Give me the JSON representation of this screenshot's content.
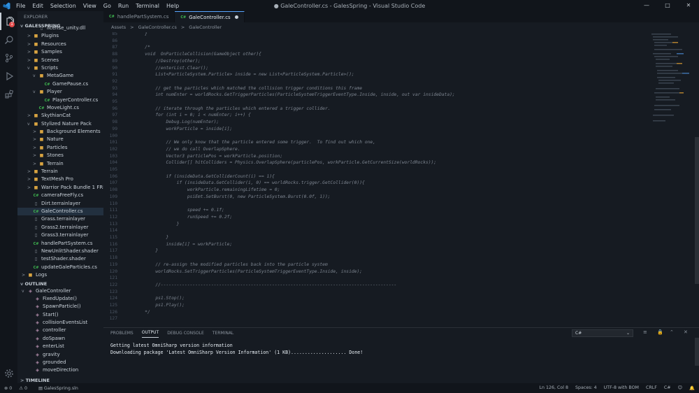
{
  "window": {
    "title": "● GaleController.cs - GalesSpring - Visual Studio Code",
    "controls": [
      "—",
      "□",
      "✕"
    ]
  },
  "menu": [
    "File",
    "Edit",
    "Selection",
    "View",
    "Go",
    "Run",
    "Terminal",
    "Help"
  ],
  "activity": {
    "badge": "1"
  },
  "sidebar": {
    "header": "EXPLORER",
    "project": "GALESSPRING",
    "tree": [
      {
        "label": "license_unity.dll",
        "type": "file",
        "depth": 2,
        "chev": ""
      },
      {
        "label": "Plugins",
        "type": "folder",
        "depth": 1,
        "chev": ">"
      },
      {
        "label": "Resources",
        "type": "folder",
        "depth": 1,
        "chev": ">"
      },
      {
        "label": "Samples",
        "type": "folder",
        "depth": 1,
        "chev": ">"
      },
      {
        "label": "Scenes",
        "type": "folder",
        "depth": 1,
        "chev": ">"
      },
      {
        "label": "Scripts",
        "type": "folder",
        "depth": 1,
        "chev": "v"
      },
      {
        "label": "MetaGame",
        "type": "folder",
        "depth": 2,
        "chev": "v"
      },
      {
        "label": "GamePause.cs",
        "type": "cs",
        "depth": 3,
        "chev": ""
      },
      {
        "label": "Player",
        "type": "folder",
        "depth": 2,
        "chev": "v"
      },
      {
        "label": "PlayerController.cs",
        "type": "cs",
        "depth": 3,
        "chev": ""
      },
      {
        "label": "MoveLight.cs",
        "type": "cs",
        "depth": 2,
        "chev": ""
      },
      {
        "label": "SkythianCat",
        "type": "folder",
        "depth": 1,
        "chev": ">"
      },
      {
        "label": "Stylized Nature Pack",
        "type": "folder",
        "depth": 1,
        "chev": "v"
      },
      {
        "label": "Background Elements",
        "type": "folder",
        "depth": 2,
        "chev": ">"
      },
      {
        "label": "Nature",
        "type": "folder",
        "depth": 2,
        "chev": ">"
      },
      {
        "label": "Particles",
        "type": "folder",
        "depth": 2,
        "chev": ">"
      },
      {
        "label": "Stones",
        "type": "folder",
        "depth": 2,
        "chev": ">"
      },
      {
        "label": "Terrain",
        "type": "folder",
        "depth": 2,
        "chev": ">"
      },
      {
        "label": "Terrain",
        "type": "folder",
        "depth": 1,
        "chev": ">"
      },
      {
        "label": "TextMesh Pro",
        "type": "folder",
        "depth": 1,
        "chev": ">"
      },
      {
        "label": "Warrior Pack Bundle 1 FREE",
        "type": "folder",
        "depth": 1,
        "chev": ">"
      },
      {
        "label": "cameraFreeFly.cs",
        "type": "cs",
        "depth": 1,
        "chev": ""
      },
      {
        "label": "Dirt.terrainlayer",
        "type": "file",
        "depth": 1,
        "chev": ""
      },
      {
        "label": "GaleController.cs",
        "type": "cs",
        "depth": 1,
        "chev": "",
        "selected": true
      },
      {
        "label": "Grass.terrainlayer",
        "type": "file",
        "depth": 1,
        "chev": ""
      },
      {
        "label": "Grass2.terrainlayer",
        "type": "file",
        "depth": 1,
        "chev": ""
      },
      {
        "label": "Grass3.terrainlayer",
        "type": "file",
        "depth": 1,
        "chev": ""
      },
      {
        "label": "handlePartSystem.cs",
        "type": "cs",
        "depth": 1,
        "chev": ""
      },
      {
        "label": "NewUnlitShader.shader",
        "type": "file",
        "depth": 1,
        "chev": ""
      },
      {
        "label": "testShader.shader",
        "type": "file",
        "depth": 1,
        "chev": ""
      },
      {
        "label": "updateGaleParticles.cs",
        "type": "cs",
        "depth": 1,
        "chev": ""
      },
      {
        "label": "Logs",
        "type": "folder",
        "depth": 0,
        "chev": ">"
      }
    ],
    "outline_header": "OUTLINE",
    "outline": [
      {
        "label": "GaleController",
        "depth": 0,
        "chev": "v"
      },
      {
        "label": "FixedUpdate()",
        "depth": 1
      },
      {
        "label": "SpawnParticle()",
        "depth": 1
      },
      {
        "label": "Start()",
        "depth": 1
      },
      {
        "label": "collisionEventsList",
        "depth": 1
      },
      {
        "label": "controller",
        "depth": 1
      },
      {
        "label": "doSpawn",
        "depth": 1
      },
      {
        "label": "enterList",
        "depth": 1
      },
      {
        "label": "gravity",
        "depth": 1
      },
      {
        "label": "grounded",
        "depth": 1
      },
      {
        "label": "moveDirection",
        "depth": 1
      }
    ],
    "timeline_header": "TIMELINE"
  },
  "tabs": [
    {
      "label": "handlePartSystem.cs",
      "active": false
    },
    {
      "label": "GaleController.cs",
      "active": true
    }
  ],
  "breadcrumbs": [
    "Assets",
    ">",
    "GaleController.cs",
    ">",
    "GaleController"
  ],
  "code": [
    {
      "n": "85",
      "t": "    }"
    },
    {
      "n": "86",
      "t": ""
    },
    {
      "n": "87",
      "t": "    /*"
    },
    {
      "n": "88",
      "t": "    void  OnParticleCollision(GameObject other){"
    },
    {
      "n": "89",
      "t": "        //Destroy(other);"
    },
    {
      "n": "90",
      "t": "        //enterList.Clear();"
    },
    {
      "n": "91",
      "t": "        List<ParticleSystem.Particle> inside = new List<ParticleSystem.Particle>();"
    },
    {
      "n": "92",
      "t": ""
    },
    {
      "n": "93",
      "t": "        // get the particles which matched the collision trigger conditions this frame"
    },
    {
      "n": "94",
      "t": "        int numEnter = worldRocks.GetTriggerParticles(ParticleSystemTriggerEventType.Inside, inside, out var insideData);"
    },
    {
      "n": "95",
      "t": ""
    },
    {
      "n": "96",
      "t": "        // iterate through the particles which entered a trigger collider."
    },
    {
      "n": "97",
      "t": "        for (int i = 0; i < numEnter; i++) {"
    },
    {
      "n": "98",
      "t": "            Debug.Log(numEnter);"
    },
    {
      "n": "99",
      "t": "            workParticle = inside[i];"
    },
    {
      "n": "100",
      "t": ""
    },
    {
      "n": "101",
      "t": "            // We only know that the particle entered some trigger.  To find out which one,"
    },
    {
      "n": "102",
      "t": "            // we do call OverlapSphere."
    },
    {
      "n": "103",
      "t": "            Vector3 particlePos = workParticle.position;"
    },
    {
      "n": "104",
      "t": "            Collider[] hitColliders = Physics.OverlapSphere(particlePos, workParticle.GetCurrentSize(worldRocks));"
    },
    {
      "n": "105",
      "t": ""
    },
    {
      "n": "106",
      "t": "            if (insideData.GetColliderCount(i) == 1){"
    },
    {
      "n": "107",
      "t": "                if (insideData.GetCollider(i, 0) == worldRocks.trigger.GetCollider(0)){"
    },
    {
      "n": "108",
      "t": "                    workParticle.remainingLifetime = 0;"
    },
    {
      "n": "109",
      "t": "                    psiEmt.SetBurst(0, new ParticleSystem.Burst(0.0f, 1));"
    },
    {
      "n": "110",
      "t": ""
    },
    {
      "n": "111",
      "t": "                    speed += 0.1f;"
    },
    {
      "n": "112",
      "t": "                    runSpeed += 0.2f;"
    },
    {
      "n": "113",
      "t": "                }"
    },
    {
      "n": "114",
      "t": ""
    },
    {
      "n": "115",
      "t": "            }"
    },
    {
      "n": "116",
      "t": "            inside[i] = workParticle;"
    },
    {
      "n": "117",
      "t": "        }"
    },
    {
      "n": "118",
      "t": ""
    },
    {
      "n": "119",
      "t": "        // re-assign the modified particles back into the particle system"
    },
    {
      "n": "120",
      "t": "        worldRocks.SetTriggerParticles(ParticleSystemTriggerEventType.Inside, inside);"
    },
    {
      "n": "121",
      "t": ""
    },
    {
      "n": "122",
      "t": "        //-----------------------------------------------------------------------------------------"
    },
    {
      "n": "123",
      "t": ""
    },
    {
      "n": "124",
      "t": "        ps1.Stop();"
    },
    {
      "n": "125",
      "t": "        ps1.Play();"
    },
    {
      "n": "126",
      "t": "    */"
    },
    {
      "n": "127",
      "t": ""
    }
  ],
  "panel": {
    "tabs": [
      {
        "label": "PROBLEMS",
        "active": false
      },
      {
        "label": "OUTPUT",
        "active": true
      },
      {
        "label": "DEBUG CONSOLE",
        "active": false
      },
      {
        "label": "TERMINAL",
        "active": false
      }
    ],
    "channel": "C#",
    "output": [
      "Getting latest OmniSharp version information",
      "Downloading package 'Latest OmniSharp Version Information' (1 KB).................... Done!"
    ]
  },
  "status": {
    "errors": "0",
    "warnings": "0",
    "project": "GalesSpring.sln",
    "position": "Ln 126, Col 8",
    "spaces": "Spaces: 4",
    "encoding": "UTF-8 with BOM",
    "eol": "CRLF",
    "language": "C#"
  },
  "colors": {
    "accent": "#58a6ff",
    "folder": "#d9a441",
    "csharp": "#3fb950",
    "comment": "#7d8590",
    "background": "#161b22"
  }
}
